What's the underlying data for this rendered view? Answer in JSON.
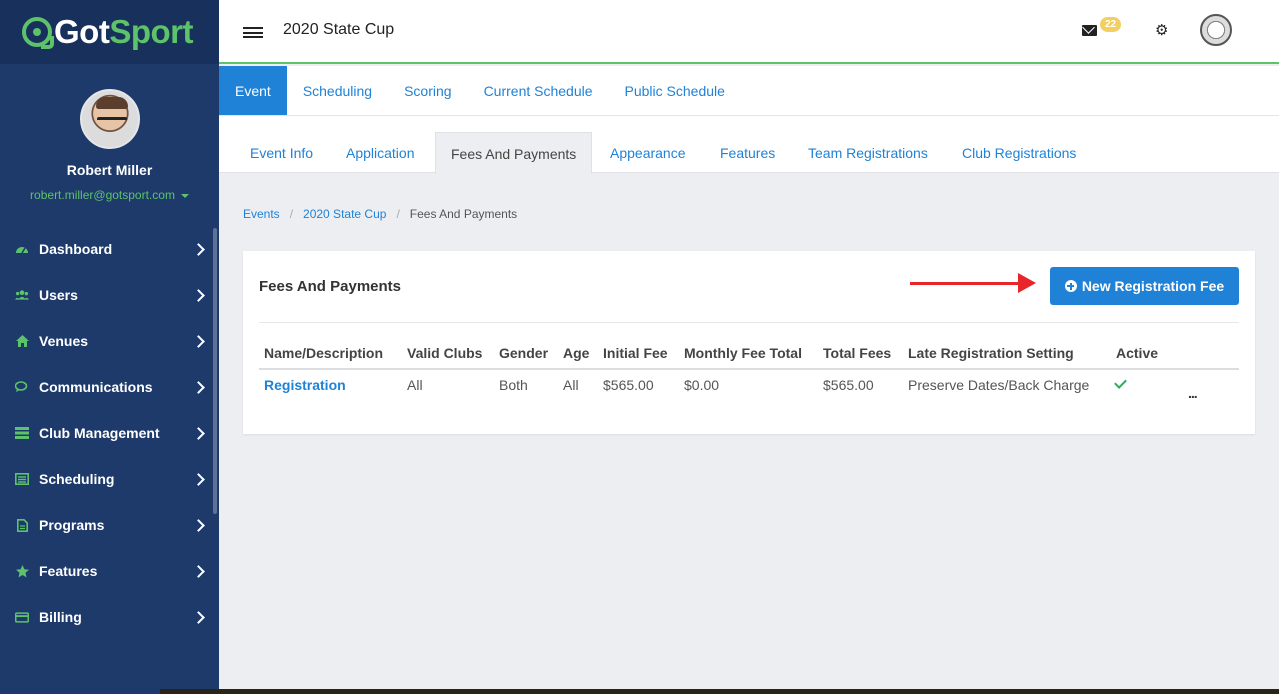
{
  "brand": {
    "logo_got": "Got",
    "logo_sport": "Sport"
  },
  "profile": {
    "name": "Robert Miller",
    "email": "robert.miller@gotsport.com"
  },
  "sidebar": {
    "items": [
      {
        "label": "Dashboard",
        "icon": "dashboard-icon"
      },
      {
        "label": "Users",
        "icon": "users-icon"
      },
      {
        "label": "Venues",
        "icon": "home-icon"
      },
      {
        "label": "Communications",
        "icon": "chat-icon"
      },
      {
        "label": "Club Management",
        "icon": "list-icon"
      },
      {
        "label": "Scheduling",
        "icon": "calendar-list-icon"
      },
      {
        "label": "Programs",
        "icon": "document-icon"
      },
      {
        "label": "Features",
        "icon": "star-icon"
      },
      {
        "label": "Billing",
        "icon": "credit-card-icon"
      }
    ]
  },
  "header": {
    "title": "2020 State Cup",
    "mail_count": "22"
  },
  "tabs_primary": [
    "Event",
    "Scheduling",
    "Scoring",
    "Current Schedule",
    "Public Schedule"
  ],
  "tabs_secondary": [
    "Event Info",
    "Application",
    "Fees And Payments",
    "Appearance",
    "Features",
    "Team Registrations",
    "Club Registrations"
  ],
  "breadcrumb": {
    "a": "Events",
    "b": "2020 State Cup",
    "c": "Fees And Payments"
  },
  "card": {
    "title": "Fees And Payments",
    "new_button": "New Registration Fee",
    "columns": [
      "Name/Description",
      "Valid Clubs",
      "Gender",
      "Age",
      "Initial Fee",
      "Monthly Fee Total",
      "Total Fees",
      "Late Registration Setting",
      "Active"
    ],
    "row": {
      "name": "Registration",
      "valid_clubs": "All",
      "gender": "Both",
      "age": "All",
      "initial_fee": "$565.00",
      "monthly_fee_total": "$0.00",
      "total_fees": "$565.00",
      "late_registration_setting": "Preserve Dates/Back Charge",
      "more": "..."
    }
  },
  "colors": {
    "sidebar": "#1d3a6b",
    "accent": "#1f82d6",
    "green": "#5dc26a",
    "arrow": "#e8262a"
  }
}
